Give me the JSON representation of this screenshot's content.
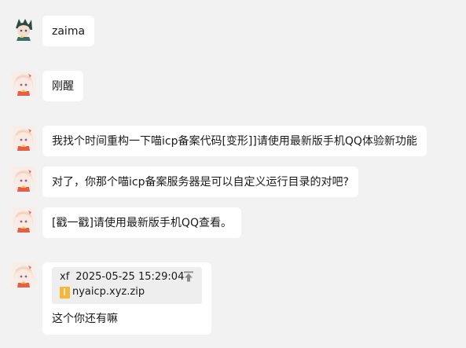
{
  "messages": [
    {
      "sender": "user-a",
      "text": "zaima"
    },
    {
      "sender": "user-b",
      "text": "刚醒"
    },
    {
      "sender": "user-b",
      "text": "我找个时间重构一下喵icp备案代码[变形]]请使用最新版手机QQ体验新功能"
    },
    {
      "sender": "user-b",
      "text": "对了，你那个喵icp备案服务器是可以自定义运行目录的对吧?"
    },
    {
      "sender": "user-b",
      "text": "[戳一戳]请使用最新版手机QQ查看。"
    }
  ],
  "file_message": {
    "uploader": "xf",
    "timestamp": "2025-05-25 15:29:04",
    "filename": "nyaicp.xyz.zip",
    "caption": "这个你还有嘛",
    "icon": "upload-arrow-icon",
    "file_icon": "zip-file-icon"
  },
  "colors": {
    "background": "#f2f2f2",
    "bubble": "#ffffff",
    "file_card": "#eeeeee",
    "file_icon": "#f4b73b"
  }
}
